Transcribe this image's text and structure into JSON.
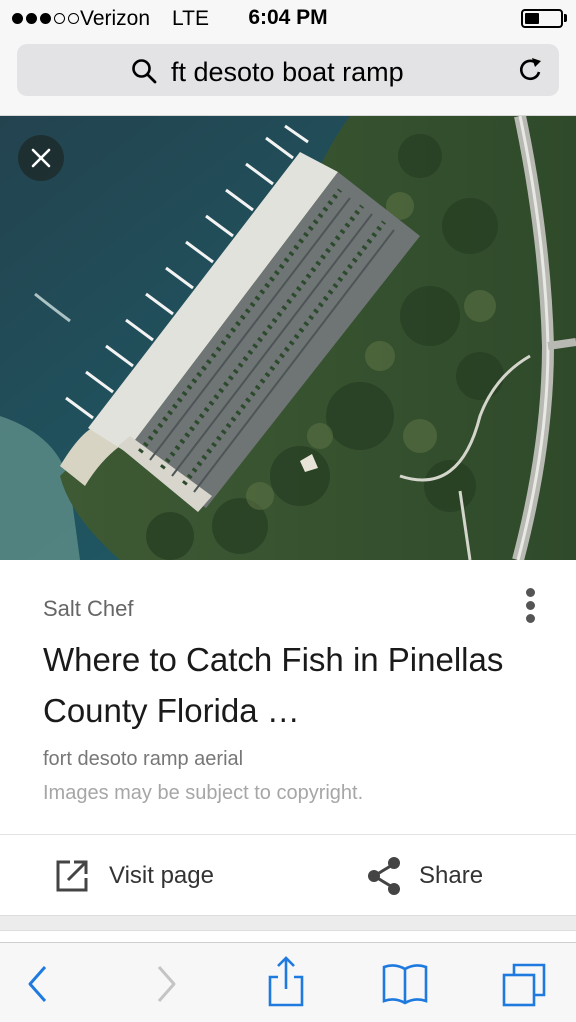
{
  "status_bar": {
    "signal_bars_filled": 3,
    "signal_bars_total": 5,
    "carrier": "Verizon",
    "network": "LTE",
    "time": "6:04 PM",
    "battery_level": 0.4
  },
  "url_bar": {
    "query": "ft desoto boat ramp",
    "search_icon": "search-icon",
    "reload_icon": "reload-icon"
  },
  "image": {
    "close_icon": "close-icon"
  },
  "result_card": {
    "source": "Salt Chef",
    "title": "Where to Catch Fish in Pinellas County Florida …",
    "caption": "fort desoto ramp aerial",
    "copyright_notice": "Images may be subject to copyright.",
    "more_icon": "more-vertical-icon",
    "visit_label": "Visit page",
    "visit_icon": "external-link-icon",
    "share_label": "Share",
    "share_icon": "share-icon"
  },
  "toolbar": {
    "items": [
      "back-icon",
      "forward-icon",
      "share-sheet-icon",
      "bookmarks-icon",
      "tabs-icon"
    ],
    "accent_color": "#1f7ae0",
    "disabled_color": "#c4c4c4"
  }
}
